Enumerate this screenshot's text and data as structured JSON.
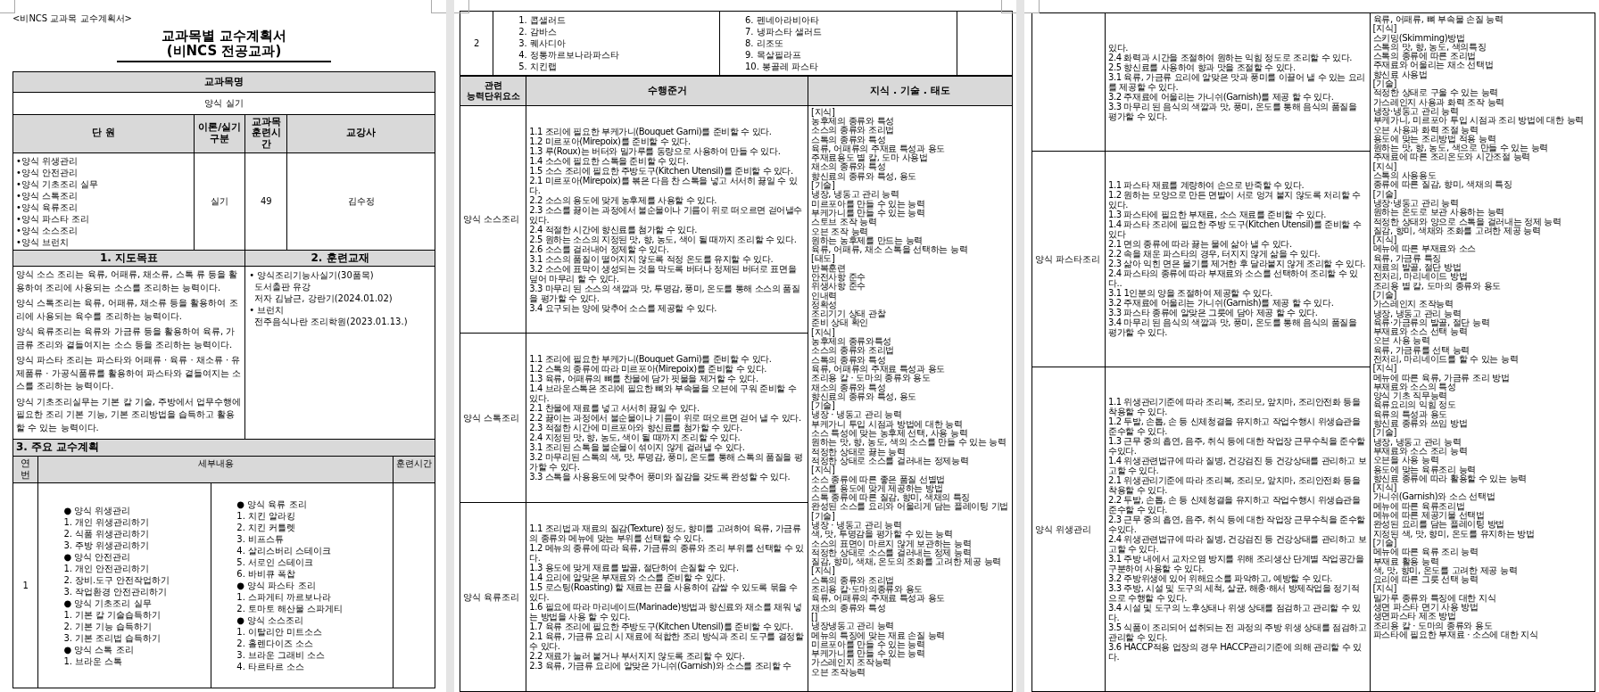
{
  "page1": {
    "header_note": "<비NCS 교과목 교수계획서>",
    "title": "교과목별 교수계획서",
    "subtitle": "(비NCS 전공교과)",
    "subject_heading": "교과목명",
    "subject": "양식 실기",
    "unit_columns": [
      "단 원",
      "이론/실기\n구분",
      "교과목\n훈련시간",
      "교강사"
    ],
    "units": [
      "•양식 위생관리",
      "•양식 안전관리",
      "•양식 기초조리 실무",
      "•양식 스톡조리",
      "•양식 육류조리",
      "•양식 파스타 조리",
      "•양식 소스조리",
      "•양식 브런치"
    ],
    "unit_type": "실기",
    "unit_hours": "49",
    "instructor": "김수정",
    "objectives_heading": "1. 지도목표",
    "textbooks_heading": "2. 훈련교재",
    "objectives": [
      "양식 소스 조리는 육류, 어패류, 채소류, 스톡 류 등을 활용하여 조리에 사용되는 소스를 조리하는 능력이다.",
      "양식 스톡조리는 육류, 어패류, 채소류 등을 활용하여 조리에 사용되는 육수를 조리하는 능력이다.",
      "양식 육류조리는 육류와 가금류 등을 활용하여 육류, 가금류 조리와 곁들여지는 소스 등을 조리하는 능력이다.",
      "양식 파스타 조리는 파스타와 어패류 · 육류 · 채소류 · 유제품류 · 가공식품류를 활용하여 파스타와 곁들여지는 소스를 조리하는 능력이다.",
      "양식 기초조리실무는 기본 칼 기술, 주방에서 업무수행에 필요한 조리 기본 기능, 기본 조리방법을 습득하고 활용할 수 있는 능력이다."
    ],
    "textbooks": [
      {
        "title": "• 양식조리기능사실기(30품목)",
        "lines": [
          "도서출판 유강",
          "저자 김남근, 강란기(2024.01.02)"
        ]
      },
      {
        "title": "• 브런치",
        "lines": [
          "전주음식나란 조리학원(2023.01.13.)"
        ]
      }
    ],
    "plan_heading": "3. 주요 교수계획",
    "plan_columns": [
      "연번",
      "세부내용",
      "훈련시간"
    ],
    "plan_rows": [
      {
        "no": "1",
        "left": [
          "● 양식 위생관리",
          "1. 개인 위생관리하기",
          "2. 식품 위생관리하기",
          "3. 주방 위생관리하기",
          "● 양식 안전관리",
          "1. 개인 안전관리하기",
          "2. 장비.도구 안전작업하기",
          "3. 작업환경 안전관리하기",
          "● 양식 기초조리 실무",
          "1. 기본 칼 기술습득하기",
          "2. 기본 기능 습득하기",
          "3. 기본 조리법 습득하기",
          "● 양식 스톡 조리",
          "1. 브라운 스톡"
        ],
        "right": [
          "● 양식 육류 조리",
          "1. 치킨 알라킹",
          "2. 치킨 커틀렛",
          "3. 비프스튜",
          "4. 살리스버리 스테이크",
          "5. 서로인 스테이크",
          "6. 바비큐 폭찹",
          "● 양식 파스타 조리",
          "1. 스파게티 까르보나라",
          "2. 토마토 해산물 스파게티",
          "● 양식 소스조리",
          "1. 이탈리안 미트소스",
          "2. 홀렌다이즈 소스",
          "3. 브라운 그래비 소스",
          "4. 타르타르 소스"
        ]
      }
    ]
  },
  "page2": {
    "plan_rows": [
      {
        "no": "2",
        "left": [
          "1. 콥샐러드",
          "2. 감바스",
          "3. 퀘사디아",
          "4. 정통까르보나라파스타",
          "5. 치킨랩"
        ],
        "right": [
          "6. 펜네아라비아타",
          "7. 냉파스타 샐러드",
          "8. 리조또",
          "9. 목살필라프",
          "10. 봉골레 파스타"
        ]
      }
    ],
    "competency_columns": [
      "관련\n능력단위요소",
      "수행준거",
      "지식 . 기술 . 태도"
    ],
    "rows": [
      {
        "element": "양식 소스조리",
        "criteria": [
          "1.1 조리에 필요한 부케가니(Bouquet Garni)를 준비할 수 있다.",
          "1.2 미르포아(Mirepoix)를 준비할 수 있다.",
          "1.3 루(Roux)는 버터와 밀가루를 동량으로 사용하여 만들 수 있다.",
          "1.4 소스에 필요한 스톡을 준비할 수 있다.",
          "1.5 소스 조리에 필요한 주방도구(Kitchen Utensil)를 준비할 수 있다.",
          "2.1 미르포아(Mirepoix)를 볶은 다음 찬 스톡을 넣고 서서히 끓일 수 있다.",
          "2.2 소스의 용도에 맞게 농후제를 사용할 수 있다.",
          "2.3 소스를 끓이는 과정에서 불순물이나 기름이 위로 떠오르면 걷어낼수 있다.",
          "2.4 적절한 시간에 향신료를 첨가할 수 있다.",
          "2.5 원하는 소스의 지정된 맛, 향, 농도, 색이 될 때까지 조리할 수 있다.",
          "2.6 소스를 걸러내어 정제할 수 있다.",
          "3.1 소스의 품질이 떨어지지 않도록 적정 온도를 유지할 수 있다.",
          "3.2 소스에 표막이 생성되는 것을 막도록 버터나 정제된 버터로 표면을 덮어 마무리 할 수 있다.",
          "3.3 마무리 된 소스의 색깔과 맛, 투명감, 풍미, 온도를 통해 소스의 품질을 평가할 수 있다.",
          "3.4 요구되는 양에 맞추어 소스를 제공할 수 있다."
        ]
      },
      {
        "element": "양식 스톡조리",
        "criteria": [
          "1.1 조리에 필요한 부케가니(Bouquet Garni)를 준비할 수 있다.",
          "1.2 스톡의 종류에 따라 미르포아(Mirepoix)를 준비할 수 있다.",
          "1.3 육류, 어패류의 뼈를 찬물에 담가 핏물을 제거할 수 있다.",
          "1.4 브라운스톡은 조리에 필요한 뼈와 부속물을 오븐에 구워 준비할 수 있다.",
          "2.1 찬물에 재료를 넣고 서서히 끓일 수 있다.",
          "2.2 끓이는 과정에서 불순물이나 기름이 위로 떠오르면 걷어 낼 수 있다.",
          "2.3 적절한 시간에 미르포아와 향신료를 첨가할 수 있다.",
          "2.4 지정된 맛, 향, 농도, 색이 될 때까지 조리할 수 있다.",
          "3.1 조리된 스톡을 불순물이 섞이지 않게 걸러낼 수 있다.",
          "3.2 마무리된 스톡의 색, 맛, 투명감, 풍미, 온도를 통해 스톡의 품질을 평가할 수 있다.",
          "3.3 스톡을 사용용도에 맞추어 풍미와 질감을 갖도록 완성할 수 있다."
        ]
      },
      {
        "element": "양식 육류조리",
        "criteria": [
          "1.1 조리법과 재료의 질감(Texture) 정도, 향미를 고려하여 육류, 가금류의 종류와 메뉴에 맞는 부위를 선택할 수 있다.",
          "1.2 메뉴의 종류에 따라 육류, 가금류의 종류와 조리 부위를 선택할 수 있다.",
          "1.3 용도에 맞게 재료를 발골, 절단하여 손질할 수 있다.",
          "1.4 요리에 알맞은 부재료와 소스를 준비할 수 있다.",
          "1.5 로스팅(Roasting) 할 재료는 끈을 사용하여 감쌀 수 있도록 묶을 수 있다.",
          "1.6 필요에 따라 마리네이드(Marinade)방법과 향신료와 채소를 채워 넣는 방법을 사용 할 수 있다.",
          "1.7 육류 조리에 필요한 주방도구(Kitchen Utensil)를 준비할 수 있다.",
          "2.1 육류, 가금류 요리 시 재료에 적합한 조리 방식과 조리 도구를 결정할 수 있다.",
          "2.2 재료가 눌러 붙거나 부서지지 않도록 조리할 수 있다.",
          "2.3 육류, 가금류 요리에 알맞은 가니쉬(Garnish)와 소스를 조리할 수"
        ]
      }
    ],
    "ksa": [
      "[지식]",
      "농후제의 종류와 특성",
      "소스의 종류와 조리법",
      "스톡의 종류와 특성",
      "육류, 어패류의 주재료 특성과 용도",
      "주재료용도 별 칼, 도마 사용법",
      "채소의 종류와 특성",
      "향신료의 종류와 특성, 용도",
      "[기술]",
      "냉장, 냉동고 관리 능력",
      "미르포아를 만들 수 있는 능력",
      "부케가니를 만들 수 있는 능력",
      "스토브 조작 능력",
      "오븐 조작 능력",
      "원하는 농후제를 만드는 능력",
      "육류, 어패류, 채소 스톡을 선택하는 능력",
      "[태도]",
      "반복훈련",
      "안전사항 준수",
      "위생사항 준수",
      "인내력",
      "정확성",
      "조리기기 상태 관찰",
      "준비 상태 확인",
      "[지식]",
      "농후제의 종류와특성",
      "소스의 종류와 조리법",
      "스톡의 종류와 특성",
      "육류, 어패류의 주재료 특성과 용도",
      "조리용 칼 · 도마의 종류와 용도",
      "채소의 종류와 특성",
      "향신료의 종류와 특성, 용도",
      "[기술]",
      "냉장 · 냉동고 관리 능력",
      "부케가니 투입 시점과 방법에 대한 능력",
      "소스 특성에 맞는 농후제 선택, 사용 능력",
      "원하는 맛, 향, 농도, 색의 소스를 만들 수 있는 능력",
      "적정한 상태로 끓는 능력",
      "적정한 상태로 소스를 걸러내는 정제능력",
      "[지식]",
      "소스 종류에 따른 좋은 품질 선별법",
      "소스를 용도에 맞게 제공하는 방법",
      "스톡 종류에 따른 질감, 향미, 색채의 특징",
      "완성된 소스를 요리와 어울리게 담는 플레이팅 기법",
      "[기술]",
      "냉장 · 냉동고 관리 능력",
      "색, 맛, 투명감을 평가할 수 있는 능력",
      "소스의 표면이 마르지 않게 보관하는 능력",
      "적정한 상태로 소스를 걸러내는 정제 능력",
      "질감, 향미, 색채, 온도의 조화를 고려한 제공 능력",
      "[지식]",
      "스톡의 종류와 조리법",
      "조리용 칼·도마의종류와 용도",
      "육류, 어패류의 주재료 특성과 용도",
      "채소의 종류와 특성",
      "[]",
      "냉장냉동고 관리 능력",
      "메뉴의 특징에 맞는 재료 손질 능력",
      "미르포아를 만들 수 있는 능력",
      "부케가니를 만들 수 있는 능력",
      "가스레인지 조작능력",
      "오븐 조작능력"
    ]
  },
  "page3": {
    "rows": [
      {
        "criteria": [
          "있다.",
          "2.4 화력과 시간을 조절하여 원하는 익힘 정도로 조리할 수 있다.",
          "2.5 향신료를 사용하여 향과 맛을 조절할 수 있다.",
          "3.1 육류, 가금류 요리에 알맞은 맛과 풍미를 이끌어 낼 수 있는 요리를 제공할 수 있다.",
          "3.2 주재료에 어울리는 가니쉬(Garnish)를 제공 할 수 있다.",
          "3.3 마무리 된 음식의 색깔과 맛, 풍미, 온도를 통해 음식의 품질을 평가할 수 있다."
        ]
      },
      {
        "element": "양식 파스타조리",
        "criteria": [
          "1.1 파스타 재료를 계량하여 손으로 반죽할 수 있다.",
          "1.2 원하는 모양으로 만든 면발이 서로 엉겨 붙지 않도록 처리할 수 있다.",
          "1.3 파스타에 필요한 부재료, 소스 재료를 준비할 수 있다.",
          "1.4 파스타 조리에 필요한 주방 도구(Kitchen Utensil)를 준비할 수 있다",
          "2.1 면의 종류에 따라 끓는 물에 삶아 낼 수 있다.",
          "2.2 속을 채운 파스타의 경우, 터지지 않게 삶을 수 있다.",
          "2.3 삶아 익힌 면은 물기를 제거한 후 달라붙지 않게 조리할 수 있다.",
          "2.4 파스타의 종류에 따라 부재료와 소스를 선택하여 조리할 수 있다..",
          "3.1 1인분의 양을 조절하여 제공할 수 있다.",
          "3.2 주재료에 어울리는 가니쉬(Garnish)를 제공 할 수 있다.",
          "3.3 파스타 종류에 알맞은 그릇에 담아 제공 할 수 있다.",
          "3.4 마무리 된 음식의 색깔과 맛, 풍미, 온도를 통해 음식의 품질을 평가할 수 있다."
        ]
      },
      {
        "element": "양식 위생관리",
        "criteria": [
          "1.1 위생관리기준에 따라 조리복, 조리모, 앞치마, 조리안전화 등을 착용할 수 있다.",
          "1.2 두발, 손톱, 손 등 신체청결을 유지하고 작업수행시 위생습관을 준수할 수 있다.",
          "1.3 근무 중의 흡연, 음주, 취식 등에 대한 작업장 근무수칙을 준수할 수있다.",
          "1.4 위생관련법규에 따라 질병, 건강검진 등 건강상태를 관리하고 보고할 수 있다.",
          "2.1 위생관리기준에 따라 조리복, 조리모, 앞치마, 조리안전화 등을 착용할 수 있다.",
          "2.2 두발, 손톱, 손 등 신체청결을 유지하고 작업수행시 위생습관을 준수할 수 있다.",
          "2.3 근무 중의 흡연, 음주, 취식 등에 대한 작업장 근무수칙을 준수할 수있다.",
          "2.4 위생관련법규에 따라 질병, 건강검진 등 건강상태를 관리하고 보고할 수 있다.",
          "3.1 주방 내에서 교차오염 방지를 위해 조리생산 단계별 작업공간을 구분하여 사용할 수 있다.",
          "3.2 주방위생에 있어 위해요소를 파악하고, 예방할 수 있다.",
          "3.3 주방, 시설 및 도구의 세척, 살균, 해충·해서 방제작업을 정기적으로 수행할 수 있다.",
          "3.4 시설 및 도구의 노후상태나 위생 상태를 점검하고 관리할 수 있다.",
          "3.5 식품이 조리되어 섭취되는 전 과정의 주방 위생 상태를 점검하고 관리할 수 있다.",
          "3.6 HACCP적용 업장의 경우 HACCP관리기준에 의해 관리할 수 있다."
        ]
      }
    ],
    "ksa": [
      "육류, 어패류, 뼈 부속물 손질 능력",
      "[지식]",
      "스키밍(Skimming)방법",
      "스톡의 맛, 향, 농도, 색의특징",
      "스톡의 종류에 따른 조리법",
      "주재료와 어울리는 채소 선택법",
      "향신료 사용법",
      "[기술]",
      "적정한 상태로 구울 수 있는 능력",
      "가스레인지 사용과 화력 조작 능력",
      "냉장·냉동고 관리 능력",
      "부케가니, 미르포아 투입 시점과 조리 방법에 대한 능력",
      "오븐 사용과 화력 조절 능력",
      "용도에 맞는 조리방법 적용 능력",
      "원하는 맛, 향, 농도, 색으로 만들 수 있는 능력",
      "주재료에 따른 조리온도와 시간조절 능력",
      "[지식]",
      "스톡의 사용용도",
      "종류에 따른 질감, 향미, 색채의 특징",
      "[기술]",
      "냉장·냉동고 관리 능력",
      "원하는 온도로 보관 사용하는 능력",
      "적정한 상태와 양으로 스톡을 걸러내는 정제 능력",
      "질감, 향미, 색채와 조화를 고려한 제공 능력",
      "[지식]",
      "메뉴에 따른 부재료와 소스",
      "육류, 가금류 특징",
      "재료의 발골, 절단 방법",
      "전처리, 마리네이드 방법",
      "조리용 별 칼, 도마의 종류와 용도",
      "[기술]",
      "가스레인지 조작능력",
      "냉장, 냉동고 관리 능력",
      "육류·가금류의 발골, 절단 능력",
      "부재료와 소스 선택 능력",
      "오븐 사용 능력",
      "육류, 가금류를 선택 능력",
      "전처리, 마리네이드를 할 수 있는 능력",
      "[지식]",
      "메뉴에 따른 육류, 가금류 조리 방법",
      "부재료와 소스의 특성",
      "양식 기초 직무능력",
      "육류요리의 익힘 정도",
      "육류의 특성과 용도",
      "향신료 종류와 쓰임 방법",
      "[기술]",
      "냉장, 냉동고 관리 능력",
      "부재료와 소스 조리 능력",
      "오븐을 사용 능력",
      "용도에 맞는 육류조리 능력",
      "향신료 종류에 따라 활용할 수 있는 능력",
      "[지식]",
      "가니쉬(Garnish)와 소스 선택법",
      "메뉴에 따른 육류조리법",
      "메뉴에 따른 제공기물 선택법",
      "완성된 요리를 담는 플레이팅 방법",
      "지정된 색, 맛, 향미, 온도를 유지하는 방법",
      "[기술]",
      "메뉴에 따른 육류 조리 능력",
      "부재료 활용 능력",
      "색, 맛, 향미, 온도를 고려한 제공 능력",
      "요리에 따른 그릇 선택 능력",
      "[지식]",
      "밀가루 종류와 특징에 대한 지식",
      "생면 파스타 면기 사용 방법",
      "생면파스타 제조 방법",
      "조리용 칼 · 도마의 종류와 용도",
      "파스타에 필요한 부재료 · 소스에 대한 지식"
    ]
  }
}
